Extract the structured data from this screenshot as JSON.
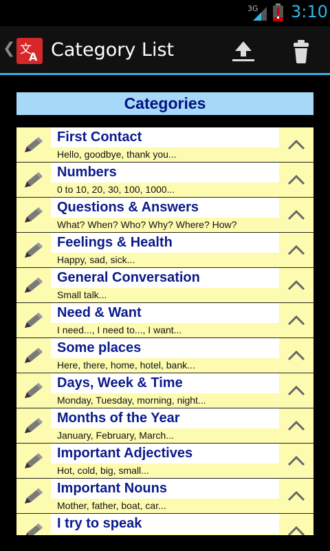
{
  "status_bar": {
    "network": "3G",
    "time": "3:10",
    "accent": "#33b5e5"
  },
  "action_bar": {
    "title": "Category List",
    "app_icon": "translate-icon",
    "actions": [
      "upload-icon",
      "trash-icon"
    ]
  },
  "header": {
    "title": "Categories"
  },
  "categories": [
    {
      "title": "First Contact",
      "description": "Hello, goodbye, thank you..."
    },
    {
      "title": "Numbers",
      "description": " 0 to 10, 20, 30, 100, 1000..."
    },
    {
      "title": "Questions & Answers",
      "description": "What? When? Who? Why? Where? How?"
    },
    {
      "title": "Feelings & Health",
      "description": "Happy, sad, sick..."
    },
    {
      "title": "General Conversation",
      "description": "Small talk..."
    },
    {
      "title": "Need & Want",
      "description": "I need..., I need to..., I want..."
    },
    {
      "title": "Some places",
      "description": "Here, there, home, hotel, bank..."
    },
    {
      "title": "Days, Week & Time",
      "description": "Monday, Tuesday, morning, night..."
    },
    {
      "title": "Months of the Year",
      "description": "January, February, March..."
    },
    {
      "title": "Important Adjectives",
      "description": "Hot, cold, big, small..."
    },
    {
      "title": "Important Nouns",
      "description": "Mother, father, boat, car..."
    },
    {
      "title": "I try to speak",
      "description": ""
    }
  ],
  "colors": {
    "header_bg": "#a8d8f8",
    "header_text": "#00137f",
    "row_accent": "#fdfbb0",
    "title_text": "#0a1a8a"
  }
}
